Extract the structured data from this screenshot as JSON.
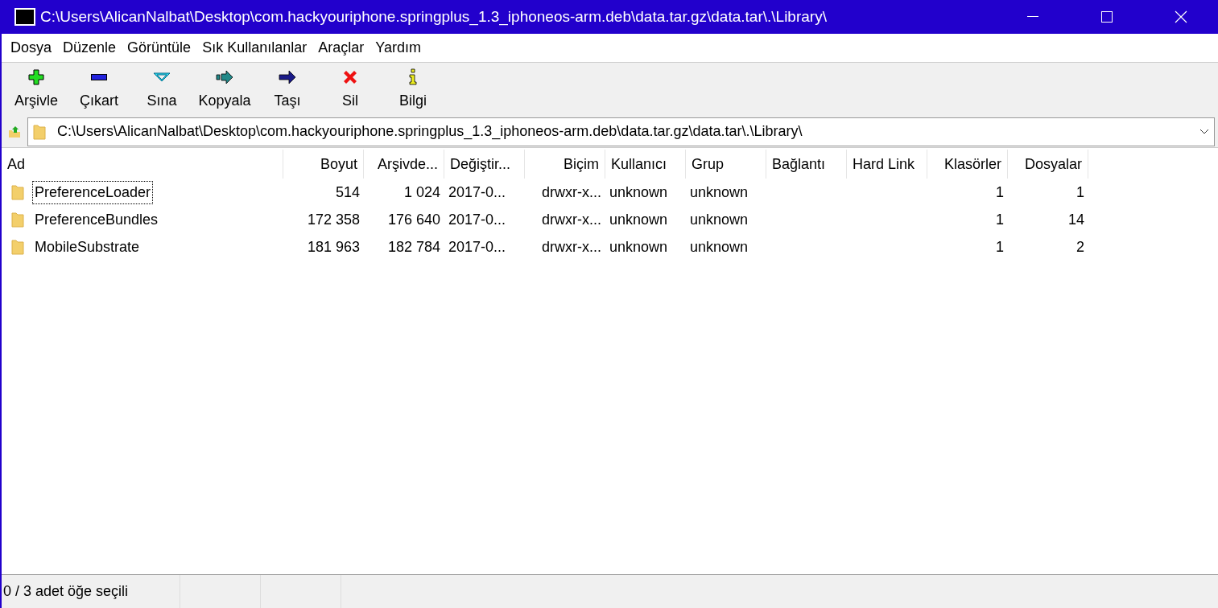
{
  "window": {
    "title": "C:\\Users\\AlicanNalbat\\Desktop\\com.hackyouriphone.springplus_1.3_iphoneos-arm.deb\\data.tar.gz\\data.tar\\.\\Library\\"
  },
  "menu": [
    "Dosya",
    "Düzenle",
    "Görüntüle",
    "Sık Kullanılanlar",
    "Araçlar",
    "Yardım"
  ],
  "toolbar": [
    {
      "kind": "add",
      "label": "Arşivle"
    },
    {
      "kind": "extract",
      "label": "Çıkart"
    },
    {
      "kind": "test",
      "label": "Sına"
    },
    {
      "kind": "copy",
      "label": "Kopyala"
    },
    {
      "kind": "move",
      "label": "Taşı"
    },
    {
      "kind": "delete",
      "label": "Sil"
    },
    {
      "kind": "info",
      "label": "Bilgi"
    }
  ],
  "address": {
    "value": "C:\\Users\\AlicanNalbat\\Desktop\\com.hackyouriphone.springplus_1.3_iphoneos-arm.deb\\data.tar.gz\\data.tar\\.\\Library\\"
  },
  "table": {
    "columns": [
      "Ad",
      "Boyut",
      "Arşivde...",
      "Değiştir...",
      "Biçim",
      "Kullanıcı",
      "Grup",
      "Bağlantı",
      "Hard Link",
      "Klasörler",
      "Dosyalar"
    ],
    "rows": [
      {
        "focused": true,
        "cells": [
          "PreferenceLoader",
          "514",
          "1 024",
          "2017-0...",
          "drwxr-x...",
          "unknown",
          "unknown",
          "",
          "",
          "1",
          "1"
        ]
      },
      {
        "focused": false,
        "cells": [
          "PreferenceBundles",
          "172 358",
          "176 640",
          "2017-0...",
          "drwxr-x...",
          "unknown",
          "unknown",
          "",
          "",
          "1",
          "14"
        ]
      },
      {
        "focused": false,
        "cells": [
          "MobileSubstrate",
          "181 963",
          "182 784",
          "2017-0...",
          "drwxr-x...",
          "unknown",
          "unknown",
          "",
          "",
          "1",
          "2"
        ]
      }
    ]
  },
  "status_bar": [
    "0 / 3 adet öğe seçili"
  ]
}
